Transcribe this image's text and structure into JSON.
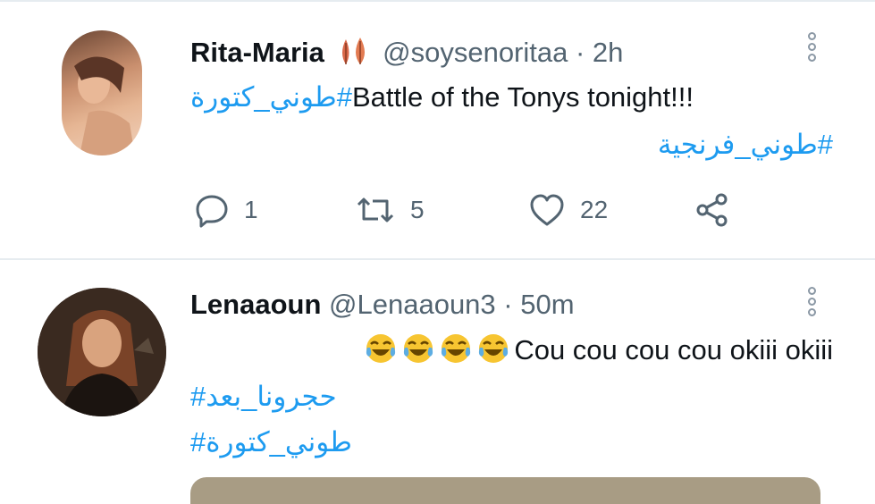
{
  "tweets": [
    {
      "name": "Rita-Maria",
      "badge_icon": "leaf-emoji-icon",
      "handle": "@soysenoritaa",
      "time": "· 2h",
      "lines": [
        {
          "hashtag": "#طوني_كتورة",
          "text": "Battle of the Tonys tonight!!!"
        },
        {
          "hashtag": "#طوني_فرنجية"
        }
      ],
      "actions": {
        "reply": "1",
        "retweet": "5",
        "like": "22"
      }
    },
    {
      "name": "Lenaaoun",
      "handle": "@Lenaaoun3",
      "time": "· 50m",
      "emojis": [
        "crying-laughing-emoji",
        "crying-laughing-emoji",
        "crying-laughing-emoji",
        "crying-laughing-emoji"
      ],
      "text": "Cou cou cou cou okiii okiii",
      "hashtags": [
        "حجرونا_بعد#",
        "طوني_كتورة#"
      ]
    }
  ],
  "colors": {
    "link": "#1d9bf0",
    "secondary": "#536471",
    "divider": "#e6ecf0"
  }
}
